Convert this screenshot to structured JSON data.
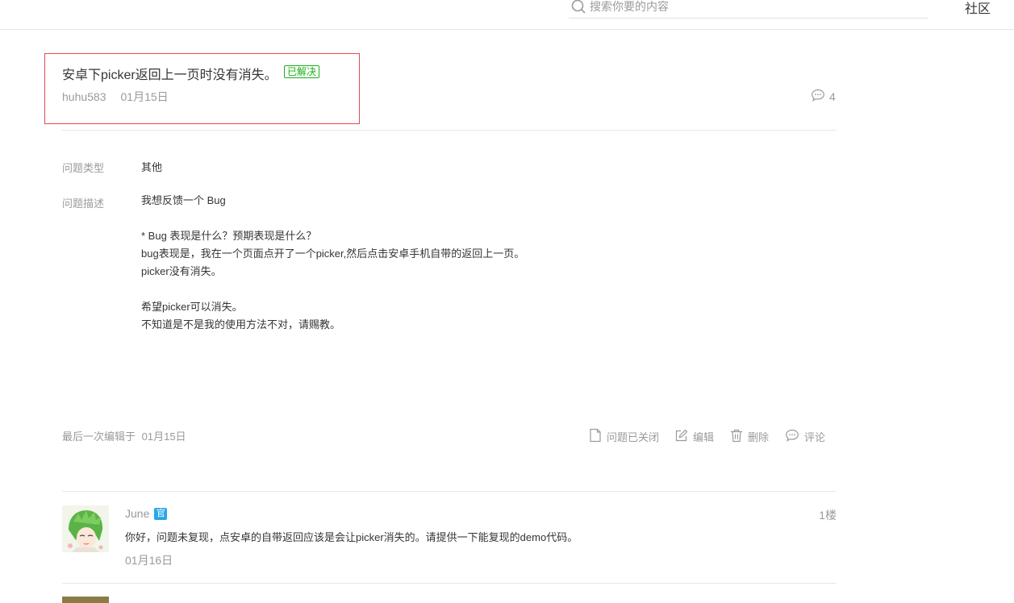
{
  "header": {
    "search_placeholder": "搜索你要的内容",
    "nav_community": "社区"
  },
  "post": {
    "title": "安卓下picker返回上一页时没有消失。",
    "status_badge": "已解决",
    "author": "huhu583",
    "date": "01月15日",
    "comment_count": "4",
    "type_label": "问题类型",
    "type_value": "其他",
    "desc_label": "问题描述",
    "description": "我想反馈一个 Bug\n\n* Bug 表现是什么？预期表现是什么？\nbug表现是，我在一个页面点开了一个picker,然后点击安卓手机自带的返回上一页。\npicker没有消失。\n\n希望picker可以消失。\n不知道是不是我的使用方法不对，请赐教。",
    "last_edit_prefix": "最后一次编辑于",
    "last_edit_date": "01月15日"
  },
  "actions": {
    "closed": "问题已关闭",
    "edit": "编辑",
    "delete": "删除",
    "comment": "评论"
  },
  "replies": [
    {
      "author": "June",
      "official_badge": "官",
      "floor": "1楼",
      "content": "你好，问题未复现，点安卓的自带返回应该是会让picker消失的。请提供一下能复现的demo代码。",
      "date": "01月16日"
    }
  ],
  "colors": {
    "accent_green": "#1aad19",
    "highlight_red": "#e24b4b",
    "official_blue": "#2aa8e6",
    "muted_text": "#9a9a9a"
  }
}
